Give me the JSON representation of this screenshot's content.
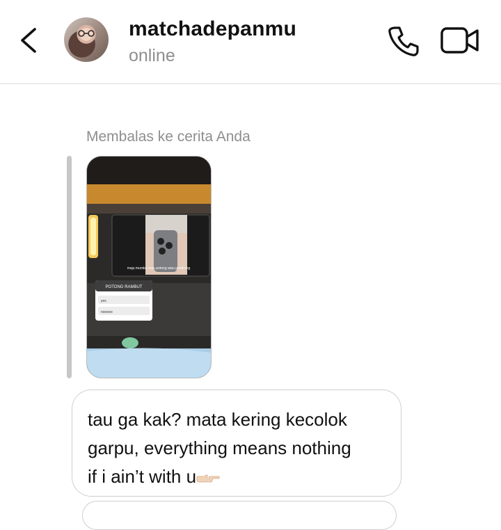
{
  "header": {
    "username": "matchadepanmu",
    "status": "online",
    "back_icon": "chevron-left-icon",
    "call_icon": "phone-icon",
    "video_icon": "video-camera-icon"
  },
  "conversation": {
    "reply_label": "Membalas ke cerita Anda",
    "story": {
      "caption": "maju mundur mau potong atau gondrong",
      "poll_title": "POTONG RAMBUT",
      "poll_options": [
        "yes",
        "nooooo"
      ]
    },
    "message": {
      "line1": "tau ga kak? mata kering kecolok",
      "line2": "garpu, everything means nothing",
      "line3": "if i ain’t with u",
      "emoji": "pointing-fingers-emoji"
    }
  },
  "colors": {
    "muted_text": "#8e8e8e",
    "bubble_border": "#cfcfcf",
    "divider": "#dcdcdc"
  }
}
